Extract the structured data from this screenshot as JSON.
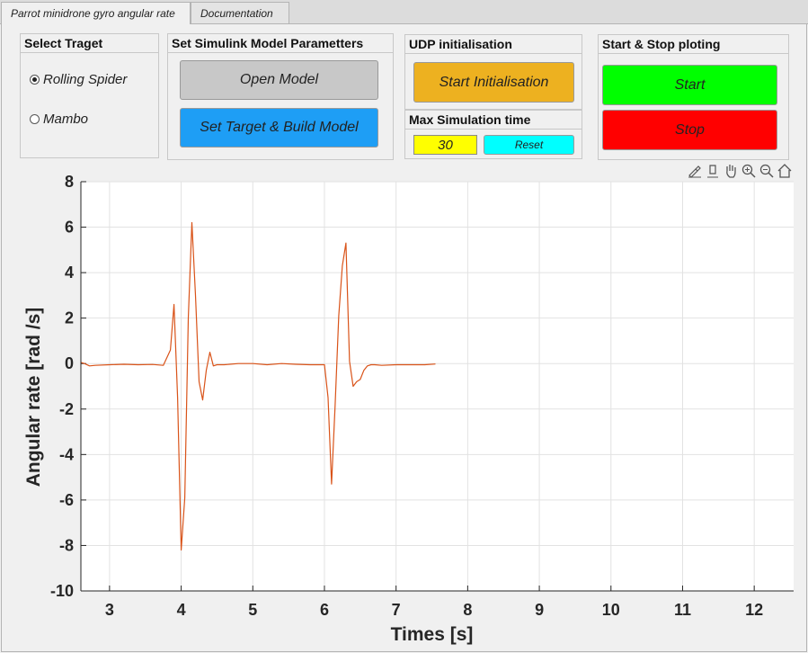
{
  "tabs": [
    {
      "label": "Parrot minidrone gyro angular rate"
    },
    {
      "label": "Documentation"
    }
  ],
  "target_panel": {
    "title": "Select Traget",
    "options": [
      {
        "label": "Rolling Spider",
        "selected": true
      },
      {
        "label": "Mambo",
        "selected": false
      }
    ]
  },
  "model_panel": {
    "title": "Set Simulink Model Parametters",
    "open_model": "Open Model",
    "set_target": "Set Target & Build Model"
  },
  "udp_panel": {
    "title": "UDP initialisation",
    "start_init": "Start Initialisation"
  },
  "maxsim_panel": {
    "title": "Max Simulation time",
    "value": "30",
    "reset": "Reset"
  },
  "startstop_panel": {
    "title": "Start & Stop ploting",
    "start": "Start",
    "stop": "Stop"
  },
  "toolbar": {
    "icons": [
      "brush-icon",
      "data-tips-icon",
      "pan-hand-icon",
      "zoom-in-icon",
      "zoom-out-icon",
      "home-icon"
    ]
  },
  "colors": {
    "open_model_bg": "#c8c8c8",
    "set_target_bg": "#1e9ef5",
    "start_init_bg": "#edb120",
    "reset_bg": "#00ffff",
    "start_bg": "#00ff00",
    "stop_bg": "#ff0000",
    "line": "#d95319"
  },
  "chart_data": {
    "type": "line",
    "xlabel": "Times [s]",
    "ylabel": "Angular rate [rad /s]",
    "xlim": [
      2.6,
      12.55
    ],
    "ylim": [
      -10,
      8
    ],
    "xticks": [
      "3",
      "4",
      "5",
      "6",
      "7",
      "8",
      "9",
      "10",
      "11",
      "12"
    ],
    "yticks": [
      "8",
      "6",
      "4",
      "2",
      "0",
      "-2",
      "-4",
      "-6",
      "-8",
      "-10"
    ],
    "grid": true,
    "series": [
      {
        "x": [
          2.6,
          2.65,
          2.72,
          2.8,
          3.0,
          3.2,
          3.4,
          3.6,
          3.75,
          3.85,
          3.9,
          3.95,
          4.0,
          4.05,
          4.1,
          4.15,
          4.2,
          4.25,
          4.3,
          4.35,
          4.4,
          4.45,
          4.5,
          4.6,
          4.8,
          5.0,
          5.2,
          5.4,
          5.6,
          5.8,
          6.0,
          6.05,
          6.1,
          6.15,
          6.2,
          6.25,
          6.3,
          6.35,
          6.4,
          6.45,
          6.5,
          6.55,
          6.6,
          6.65,
          6.7,
          6.8,
          7.0,
          7.2,
          7.4,
          7.55
        ],
        "y": [
          0.05,
          0.0,
          -0.1,
          -0.08,
          -0.05,
          -0.03,
          -0.05,
          -0.04,
          -0.08,
          0.6,
          2.6,
          -1.5,
          -8.2,
          -5.9,
          2.0,
          6.2,
          3.0,
          -0.8,
          -1.6,
          -0.3,
          0.5,
          -0.1,
          -0.05,
          -0.05,
          0.0,
          0.0,
          -0.05,
          0.0,
          -0.03,
          -0.05,
          -0.05,
          -1.5,
          -5.3,
          -1.8,
          2.1,
          4.3,
          5.3,
          0.1,
          -1.0,
          -0.8,
          -0.7,
          -0.3,
          -0.1,
          -0.05,
          -0.05,
          -0.08,
          -0.05,
          -0.05,
          -0.05,
          -0.02
        ]
      }
    ]
  }
}
